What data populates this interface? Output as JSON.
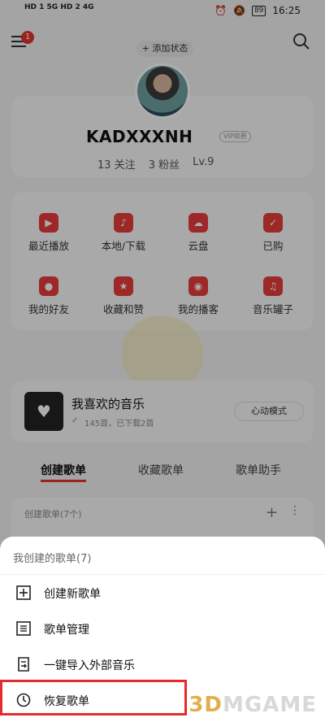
{
  "status_bar": {
    "left_text": "HD 1 5G HD 2 4G",
    "battery": "89",
    "time": "16:25"
  },
  "top": {
    "menu_badge": "1",
    "add_status": "+ 添加状态"
  },
  "profile": {
    "username": "KADXXXNH",
    "vip": "VIP续费",
    "follow": "13 关注",
    "fans": "3 粉丝",
    "level": "Lv.9"
  },
  "grid": [
    {
      "label": "最近播放",
      "icon": "play-icon"
    },
    {
      "label": "本地/下载",
      "icon": "music-note-icon"
    },
    {
      "label": "云盘",
      "icon": "cloud-upload-icon"
    },
    {
      "label": "已购",
      "icon": "shopping-bag-icon"
    },
    {
      "label": "我的好友",
      "icon": "friends-icon"
    },
    {
      "label": "收藏和赞",
      "icon": "star-icon"
    },
    {
      "label": "我的播客",
      "icon": "podcast-icon"
    },
    {
      "label": "音乐罐子",
      "icon": "jar-icon"
    }
  ],
  "liked": {
    "title": "我喜欢的音乐",
    "subtitle": "145首，已下载2首",
    "heart_mode": "心动模式"
  },
  "tabs": [
    "创建歌单",
    "收藏歌单",
    "歌单助手"
  ],
  "created": {
    "title": "创建歌单(7个)"
  },
  "sheet": {
    "title": "我创建的歌单(7)",
    "items": [
      {
        "label": "创建新歌单",
        "icon": "plus-square-icon"
      },
      {
        "label": "歌单管理",
        "icon": "list-icon"
      },
      {
        "label": "一键导入外部音乐",
        "icon": "import-icon"
      },
      {
        "label": "恢复歌单",
        "icon": "history-icon"
      }
    ]
  },
  "watermark": {
    "prefix": "3D",
    "suffix": "MGAME"
  },
  "colors": {
    "accent": "#e3342f",
    "highlight_box": "#e52b2b"
  }
}
